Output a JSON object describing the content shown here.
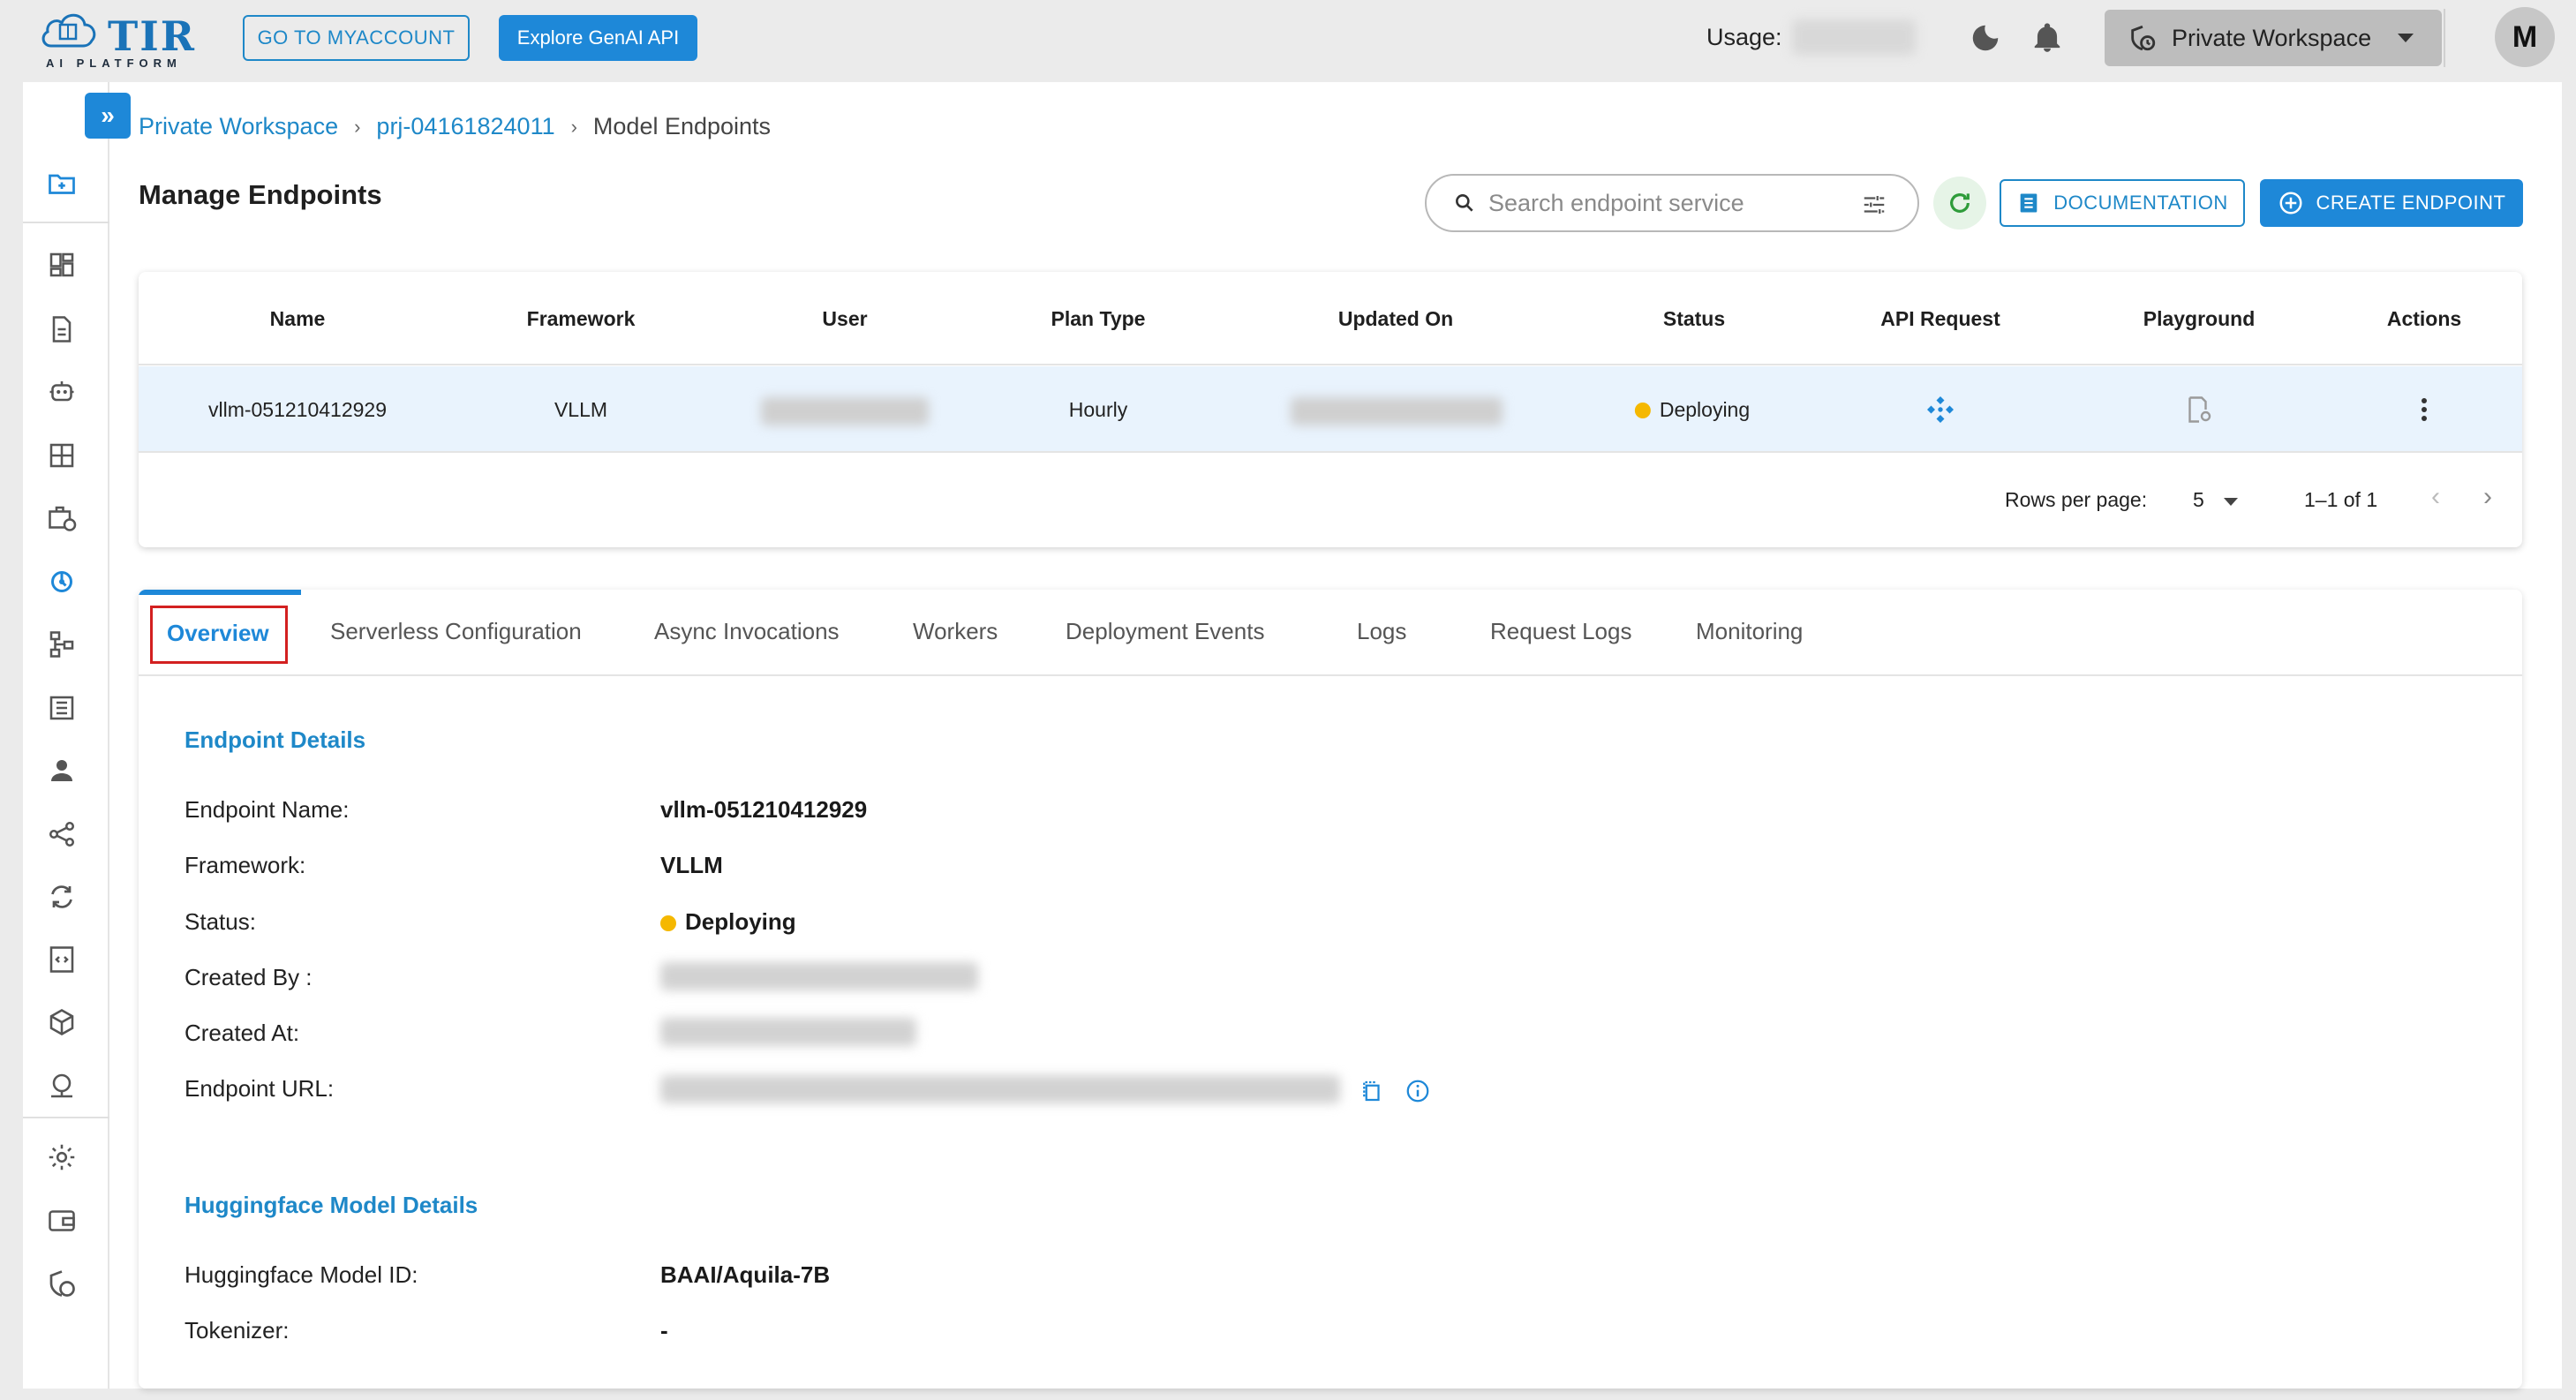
{
  "topbar": {
    "logo_text": "TIR",
    "logo_sub": "AI PLATFORM",
    "myaccount_label": "GO TO MYACCOUNT",
    "genai_label": "Explore GenAI API",
    "usage_label": "Usage:",
    "workspace_label": "Private Workspace",
    "avatar_letter": "M"
  },
  "breadcrumb": {
    "items": [
      "Private Workspace",
      "prj-04161824011",
      "Model Endpoints"
    ]
  },
  "page": {
    "title": "Manage Endpoints",
    "search_placeholder": "Search endpoint service",
    "documentation_label": "DOCUMENTATION",
    "create_label": "CREATE ENDPOINT"
  },
  "table": {
    "columns": [
      "Name",
      "Framework",
      "User",
      "Plan Type",
      "Updated On",
      "Status",
      "API Request",
      "Playground",
      "Actions"
    ],
    "rows": [
      {
        "name": "vllm-051210412929",
        "framework": "VLLM",
        "plan_type": "Hourly",
        "status": "Deploying"
      }
    ],
    "rows_per_page_label": "Rows per page:",
    "rows_per_page": "5",
    "range": "1–1 of 1"
  },
  "tabs": [
    "Overview",
    "Serverless Configuration",
    "Async Invocations",
    "Workers",
    "Deployment Events",
    "Logs",
    "Request Logs",
    "Monitoring"
  ],
  "endpoint_details": {
    "title": "Endpoint Details",
    "name_label": "Endpoint Name:",
    "name_value": "vllm-051210412929",
    "framework_label": "Framework:",
    "framework_value": "VLLM",
    "status_label": "Status:",
    "status_value": "Deploying",
    "created_by_label": "Created By :",
    "created_at_label": "Created At:",
    "url_label": "Endpoint URL:"
  },
  "hf_details": {
    "title": "Huggingface Model Details",
    "model_id_label": "Huggingface Model ID:",
    "model_id_value": "BAAI/Aquila-7B",
    "tokenizer_label": "Tokenizer:",
    "tokenizer_value": "-"
  },
  "colors": {
    "accent": "#1e88d8",
    "status_deploying": "#f5b800",
    "row_highlight": "#e9f3fd"
  }
}
